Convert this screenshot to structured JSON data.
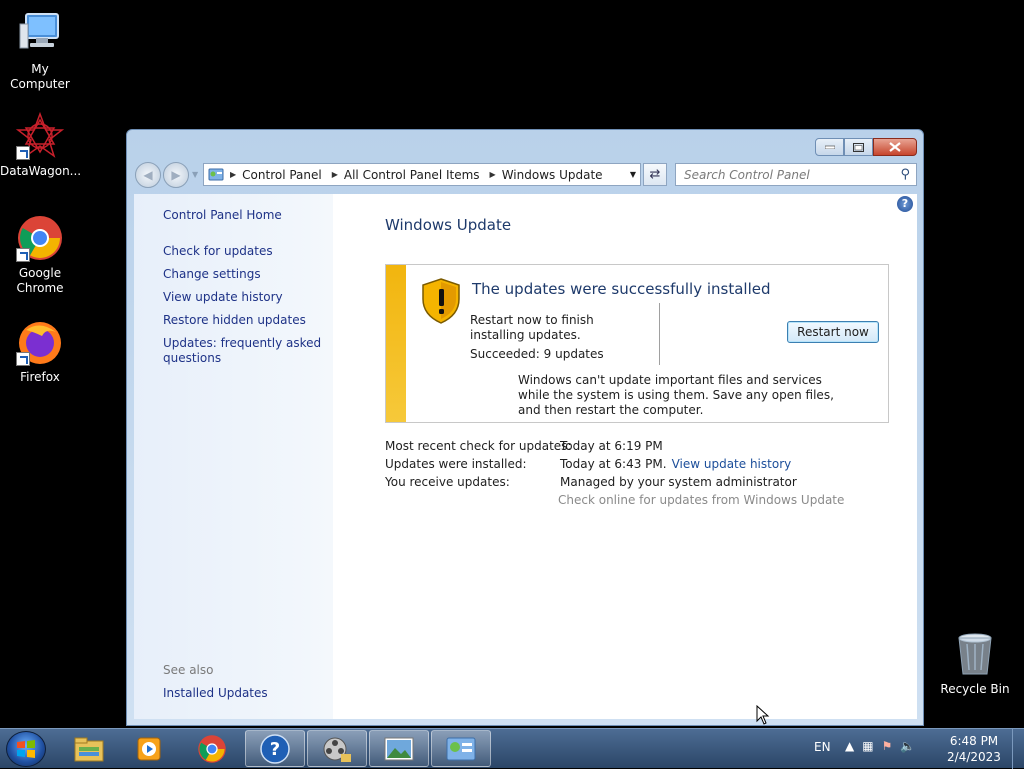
{
  "desktop": {
    "icons": [
      {
        "label": "My Computer"
      },
      {
        "label": "DataWagon..."
      },
      {
        "label": "Google Chrome"
      },
      {
        "label": "Firefox"
      },
      {
        "label": "Recycle Bin"
      }
    ]
  },
  "window": {
    "address": {
      "crumbs": [
        "Control Panel",
        "All Control Panel Items",
        "Windows Update"
      ]
    },
    "search": {
      "placeholder": "Search Control Panel"
    },
    "side": {
      "home": "Control Panel Home",
      "links": [
        "Check for updates",
        "Change settings",
        "View update history",
        "Restore hidden updates",
        "Updates: frequently asked questions"
      ],
      "see_also": "See also",
      "installed": "Installed Updates"
    },
    "main": {
      "title": "Windows Update",
      "status": {
        "heading": "The updates were successfully installed",
        "message": "Restart now to finish installing updates.",
        "succeeded": "Succeeded: 9 updates",
        "restart_label": "Restart now",
        "note": "Windows can't update important files and services while the system is using them. Save any open files, and then restart the computer.",
        "bar_color": "#f2b50e"
      },
      "info": {
        "recent_label": "Most recent check for updates:",
        "recent_value": "Today at 6:19 PM",
        "installed_label": "Updates were installed:",
        "installed_value": "Today at 6:43 PM.",
        "history_link": "View update history",
        "receive_label": "You receive updates:",
        "receive_value": "Managed by your system administrator",
        "check_online": "Check online for updates from Windows Update"
      }
    }
  },
  "taskbar": {
    "apps": [
      "file-explorer-icon",
      "media-player-icon",
      "chrome-icon",
      "help-icon",
      "movie-maker-icon",
      "photo-viewer-icon",
      "control-panel-icon"
    ],
    "lang": "EN",
    "time": "6:48 PM",
    "date": "2/4/2023"
  }
}
